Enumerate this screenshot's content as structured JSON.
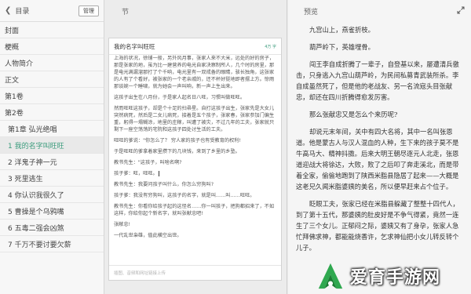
{
  "sidebar": {
    "back_icon": "chevron-left",
    "title": "目录",
    "manage_label": "管理",
    "items": [
      {
        "label": "封面",
        "sub": false,
        "active": false
      },
      {
        "label": "梗概",
        "sub": false,
        "active": false
      },
      {
        "label": "人物简介",
        "sub": false,
        "active": false
      },
      {
        "label": "正文",
        "sub": false,
        "active": false
      },
      {
        "label": "第1卷",
        "sub": false,
        "active": false
      },
      {
        "label": "第2卷",
        "sub": false,
        "active": false
      },
      {
        "label": "第1章 弘光绝唱",
        "sub": true,
        "active": false
      },
      {
        "label": "1 我的名字叫旺旺",
        "sub": true,
        "active": true
      },
      {
        "label": "2 洋鬼子神一元",
        "sub": true,
        "active": false
      },
      {
        "label": "3 死里逃生",
        "sub": true,
        "active": false
      },
      {
        "label": "4 你认识我很久了",
        "sub": true,
        "active": false
      },
      {
        "label": "5 曹操是个乌鸦嘴",
        "sub": true,
        "active": false
      },
      {
        "label": "6 五毒二强会凶煞",
        "sub": true,
        "active": false
      },
      {
        "label": "7 千万不要讨要欠薪",
        "sub": true,
        "active": false
      }
    ]
  },
  "editor": {
    "header": "节",
    "title": "我的名字叫旺旺",
    "char_count": "4万 字",
    "paragraphs": [
      "上海的状况，徐铺一般，另外风月事，张家人来不大米，远处的好的房子，那是张家的地，虽为比一建营养的电光自家决察制所人，几个时的房里，那是电光满漏溜那打了个千响，电光里有一双戒备的眼睛，骇长独角，这张家的人有了个看好，被张家的一个老亲戚的，还不杯好挺地即者摆上方。惊雨那谈婉一个睡啸，就为她会一声叫响，新一声上生出来。",
      "这孩子出生在八月份，于是家人起名日八旺，习惯叫做旺旺。",
      "然而旺旺这孩子，却是个十足的扫帚星。自打这孩子出生，张家先是大女儿突然病死，然后是二女儿病死，接着是五个孩子，张家春，张家参加门偏生重，躬得一塌糊涂，地里的庄稼，叫遭了被灾，不过几年的工夫，张家就只剩下一座空荡荡的宅院和这孩子四处讨生活的工夫。",
      "旺旺的爹说：\"你怎么了？ 穷人家的孩子也有受教育的权利!",
      "于是旺旺的爹拿着家里攒下的几块钱，来到了乡里的乡塾。",
      "教书先生：\"这孩子，叫啥名啊?",
      "孩子爹：旺，旺旺。",
      "教书先生：我要问孩子叫什么，你怎么穷狗叫?",
      "孩子爹：我没有穷狗叫，这孩子的名字，就是叫……叫……旺旺。",
      "教书先生：你看你给孩子起的这怪名……你一叫孩子，把狗都招来了，不如这样，你给你起个新名字，就叫张献忠吧!",
      "张献忠!",
      "一代乱世枭雄，值此横空出世。"
    ],
    "footer_placeholder": "插图、音频和网址链接上传"
  },
  "preview": {
    "header": "预览",
    "expand_icon": "expand-arrows",
    "paragraphs": [
      "九宫山上，燕雀折枝。",
      "葫芦岭下，英雄埋骨。",
      "闯王李自成折腾了一辈子，自登基以来，屡遭清兵徼击，只身逃入九宫山葫芦岭，为民间私募青武装所杀。李自成虽然死了，但是他的老战友、另一名流寇头目张献忠，却还在四川折腾得愈发厉害。",
      "那么张献忠又是怎么个来历呢?",
      "却说元末年间，关中有四大名将，其中一名叫张恩道。他是蒙古人与汉人混血的人种，生下来的孩子莫不是牛高马大、精神抖擞。后来大明王朝尽逐元人北走，张恩道迎战大将徐达，大败，败了之后叩了奔走溪北，而是带着全家，偷偷地跑到了陕西米脂县隐居了起来——大概是这老兄久闻米脂婆姨的美名，所以便早赶来占个位子。",
      "眨眼工夫，张家已经在米脂县躲藏了整整十四代人，到了第十五代，那婆姨的肚皮好是不争气得紧，竟然一连生了三个女儿。正郁闷之际，婆姨又有了身孕，张家人急忙拜佛求神，都能能烧香许，乞求神仙把小女儿转反转个儿子。"
    ]
  },
  "watermark": {
    "text": "爱育手游网",
    "logo_icon": "a-letter-logo"
  }
}
